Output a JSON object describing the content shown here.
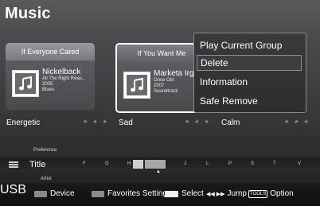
{
  "app": {
    "title": "Music"
  },
  "cards": [
    {
      "header": "If Everyone Cared",
      "artist": "Nickelback",
      "album": "All The Right Reas..",
      "year": "2005",
      "genre": "Blues",
      "icon": "music-note-icon"
    },
    {
      "header": "If You Want Me",
      "artist": "Marketa Irg",
      "album": "Once Ost",
      "year": "2007",
      "genre": "Soundtrack",
      "icon": "music-note-icon"
    }
  ],
  "moods": [
    {
      "label": "Energetic",
      "stars": "★ ★ ★"
    },
    {
      "label": "Sad",
      "stars": "★ ★ ★"
    },
    {
      "label": "Calm",
      "stars": "★ ★ ★"
    }
  ],
  "menu": {
    "items": [
      {
        "label": "Play Current Group",
        "selected": false
      },
      {
        "label": "Delete",
        "selected": true
      },
      {
        "label": "Information",
        "selected": false
      },
      {
        "label": "Safe Remove",
        "selected": false
      }
    ]
  },
  "sort": {
    "above": "Preference",
    "current": "Title",
    "below": "Artist",
    "letters": [
      "F",
      "G",
      "H",
      "J",
      "L",
      "P",
      "S",
      "T",
      "V"
    ]
  },
  "bottom": {
    "source": "USB",
    "hints": [
      {
        "label": "Device",
        "chip_color": "#8a8a8d"
      },
      {
        "label": "Favorites Setting",
        "chip_color": "#8a8a8d"
      },
      {
        "label": "Select",
        "chip_color": "#f0f0f0"
      },
      {
        "label": "Jump",
        "glyph": "◀◀ ▶▶"
      },
      {
        "label": "Option",
        "glyph": "TOOLS"
      }
    ]
  },
  "colors": {
    "accent_border": "#ffffff",
    "menu_background": "#333336",
    "menu_selected_border": "#8f8f93"
  }
}
